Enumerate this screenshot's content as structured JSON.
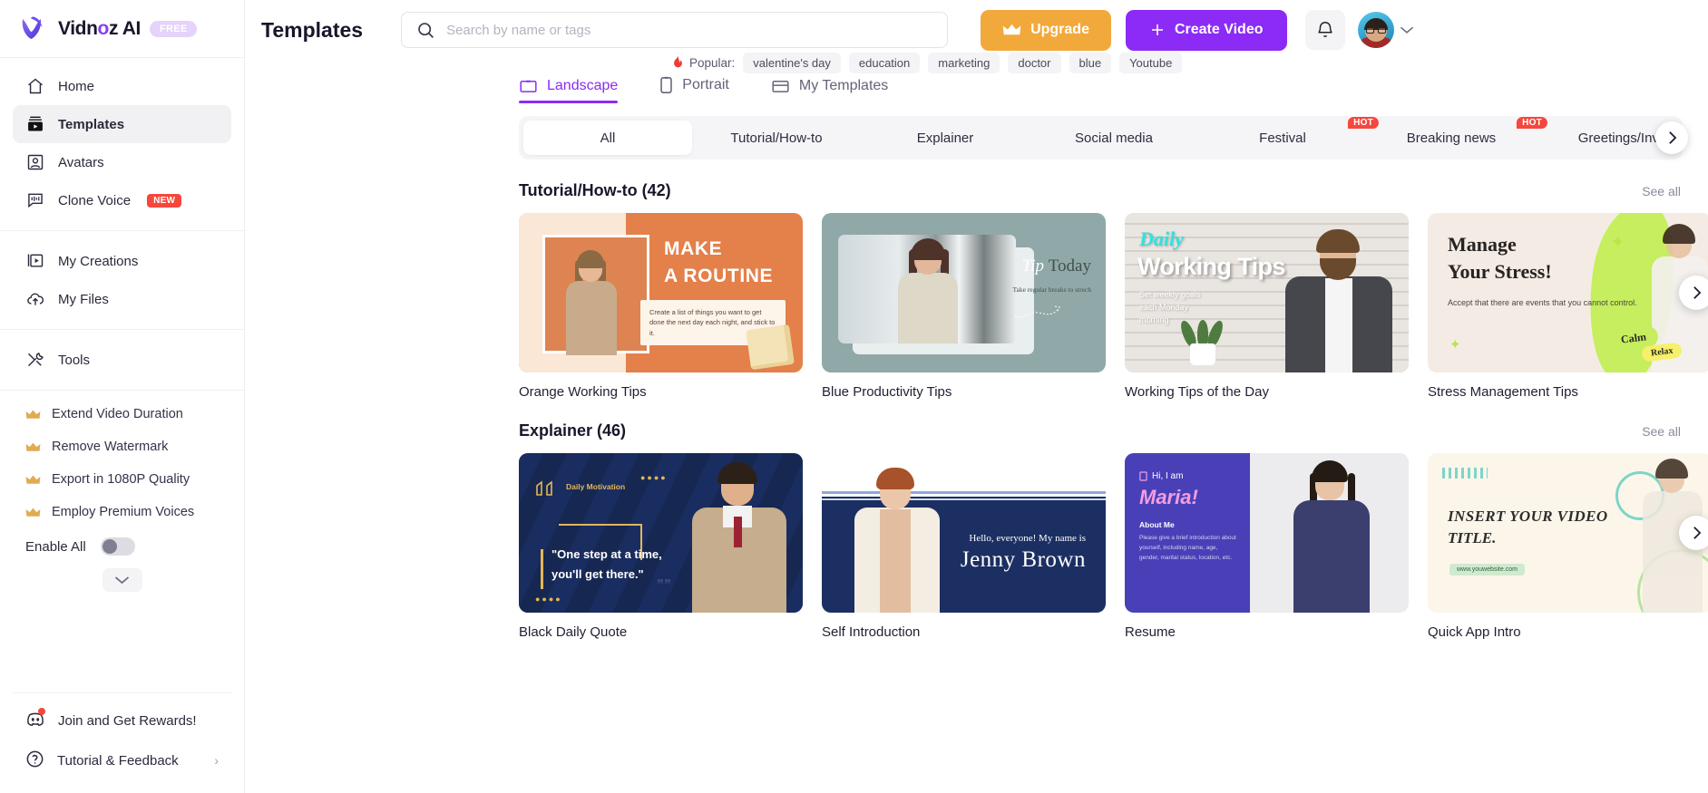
{
  "brand": {
    "name_before": "Vidn",
    "name_o": "o",
    "name_after": "z AI",
    "plan_badge": "FREE"
  },
  "sidebar": {
    "nav": [
      {
        "label": "Home",
        "icon": "home-icon"
      },
      {
        "label": "Templates",
        "icon": "templates-icon",
        "active": true
      },
      {
        "label": "Avatars",
        "icon": "avatar-icon"
      },
      {
        "label": "Clone Voice",
        "icon": "voice-icon",
        "badge": "NEW"
      }
    ],
    "nav2": [
      {
        "label": "My Creations",
        "icon": "my-creations-icon"
      },
      {
        "label": "My Files",
        "icon": "my-files-icon"
      }
    ],
    "nav3": [
      {
        "label": "Tools",
        "icon": "tools-icon"
      }
    ],
    "promos": [
      {
        "label": "Extend Video Duration"
      },
      {
        "label": "Remove Watermark"
      },
      {
        "label": "Export in 1080P Quality"
      },
      {
        "label": "Employ Premium Voices"
      }
    ],
    "enable_all_label": "Enable All",
    "enable_all_on": false,
    "bottom": [
      {
        "label": "Join and Get Rewards!",
        "icon": "discord-icon",
        "dot": true
      },
      {
        "label": "Tutorial & Feedback",
        "icon": "help-icon",
        "chevron": "›"
      }
    ]
  },
  "header": {
    "title": "Templates",
    "search_placeholder": "Search by name or tags",
    "search_value": "",
    "upgrade_label": "Upgrade",
    "create_label": "Create Video",
    "popular_label": "Popular:",
    "popular_tags": [
      "valentine's day",
      "education",
      "marketing",
      "doctor",
      "blue",
      "Youtube"
    ]
  },
  "view_tabs": [
    {
      "label": "Landscape",
      "icon": "landscape-icon",
      "active": true
    },
    {
      "label": "Portrait",
      "icon": "portrait-icon",
      "active": false
    },
    {
      "label": "My Templates",
      "icon": "my-templates-icon",
      "active": false
    }
  ],
  "categories": [
    {
      "label": "All",
      "active": true
    },
    {
      "label": "Tutorial/How-to"
    },
    {
      "label": "Explainer"
    },
    {
      "label": "Social media"
    },
    {
      "label": "Festival",
      "badge": "HOT"
    },
    {
      "label": "Breaking news",
      "badge": "HOT"
    },
    {
      "label": "Greetings/Invi"
    }
  ],
  "sections": [
    {
      "title": "Tutorial/How-to (42)",
      "see_all": "See all",
      "cards": [
        {
          "label": "Orange Working Tips",
          "art": "t1",
          "art_text": {
            "h1": "MAKE",
            "h2": "A ROUTINE",
            "note": "Create a list of things you want to get done the next day each night, and stick to it."
          }
        },
        {
          "label": "Blue Productivity Tips",
          "art": "t2",
          "art_text": {
            "tip": "Tip",
            "today": "Today",
            "sub": "Take regular breaks to strech"
          }
        },
        {
          "label": "Working Tips of the Day",
          "art": "t3",
          "art_text": {
            "daily": "Daily",
            "title": "Working Tips",
            "sub": "Set weekly goals\neach Monday\nmorning"
          }
        },
        {
          "label": "Stress Management Tips",
          "art": "t4",
          "art_text": {
            "m1": "Manage",
            "m2": "Your Stress!",
            "m3": "Accept that there are events that you cannot control.",
            "calm": "Calm",
            "relax": "Relax"
          }
        }
      ]
    },
    {
      "title": "Explainer (46)",
      "see_all": "See all",
      "cards": [
        {
          "label": "Black Daily Quote",
          "art": "t5",
          "art_text": {
            "dm": "Daily Motivation",
            "q1": "\"One step at a time,",
            "q2": "you'll get there.\""
          }
        },
        {
          "label": "Self Introduction",
          "art": "t6",
          "art_text": {
            "hello": "Hello, everyone! My name is",
            "jenny": "Jenny Brown"
          }
        },
        {
          "label": "Resume",
          "art": "t7",
          "art_text": {
            "hi": "Hi, I am",
            "maria": "Maria!",
            "about": "About Me",
            "abtxt": "Please give a brief introduction about yourself, including name, age, gender, marital status, location, etc."
          }
        },
        {
          "label": "Quick App Intro",
          "art": "t8",
          "art_text": {
            "i1": "INSERT YOUR VIDEO",
            "i2": "TITLE.",
            "url": "www.youwebsite.com"
          }
        }
      ]
    }
  ],
  "colors": {
    "accent_purple": "#8b2bf5",
    "upgrade_orange": "#f2a93b",
    "hot_red": "#f5473d",
    "new_red": "#f5473d"
  }
}
